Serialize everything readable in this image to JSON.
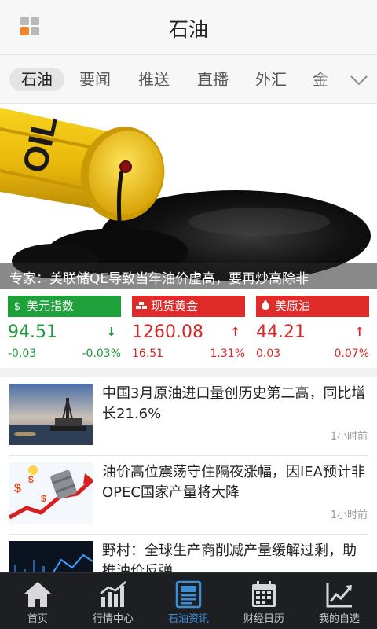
{
  "header": {
    "title": "石油"
  },
  "tabs": [
    {
      "label": "石油"
    },
    {
      "label": "要闻"
    },
    {
      "label": "推送"
    },
    {
      "label": "直播"
    },
    {
      "label": "外汇"
    },
    {
      "label": "金"
    }
  ],
  "banner": {
    "barrel_text": "OIL",
    "caption": "专家：美联储QE导致当年油价虚高，要再炒高除非"
  },
  "tickers": [
    {
      "name": "美元指数",
      "icon": "dollar-icon",
      "price": "94.51",
      "arrow": "↓",
      "change": "-0.03",
      "pct": "-0.03%",
      "head_color": "#1ea13b",
      "text_color": "#1d9a3a"
    },
    {
      "name": "现货黄金",
      "icon": "gold-bars-icon",
      "price": "1260.08",
      "arrow": "↑",
      "change": "16.51",
      "pct": "1.31%",
      "head_color": "#e02b2b",
      "text_color": "#d62626"
    },
    {
      "name": "美原油",
      "icon": "oil-drop-icon",
      "price": "44.21",
      "arrow": "↑",
      "change": "0.03",
      "pct": "0.07%",
      "head_color": "#e02b2b",
      "text_color": "#d62626"
    }
  ],
  "news": [
    {
      "title": "中国3月原油进口量创历史第二高，同比增长21.6%",
      "time": "1小时前"
    },
    {
      "title": "油价高位震荡守住隔夜涨幅，因IEA预计非OPEC国家产量将大降",
      "time": "1小时前"
    },
    {
      "title": "野村：全球生产商削减产量缓解过剩，助推油价反弹",
      "time": ""
    }
  ],
  "nav": [
    {
      "label": "首页",
      "icon": "home-icon"
    },
    {
      "label": "行情中心",
      "icon": "chart-bars-icon"
    },
    {
      "label": "石油资讯",
      "icon": "newspaper-icon"
    },
    {
      "label": "财经日历",
      "icon": "calendar-icon"
    },
    {
      "label": "我的自选",
      "icon": "trend-line-icon"
    }
  ],
  "colors": {
    "accent": "#3a8fd9",
    "up": "#d62626",
    "down": "#1d9a3a",
    "nav_bg": "#1d1f23",
    "brand_orange": "#f0842b"
  }
}
